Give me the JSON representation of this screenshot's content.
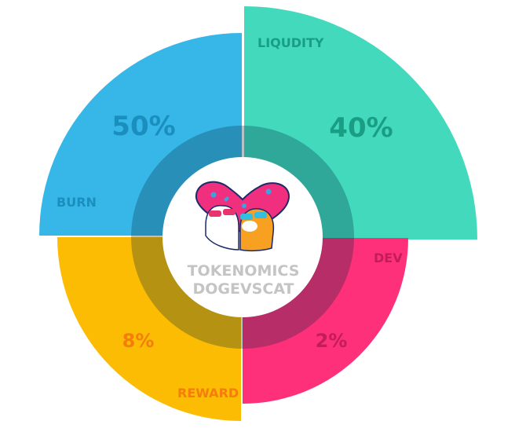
{
  "chart_data": {
    "type": "pie",
    "categories": [
      "LIQUDITY",
      "DEV",
      "REWARD",
      "BURN"
    ],
    "values": [
      40,
      2,
      8,
      50
    ],
    "labels": [
      "40%",
      "2%",
      "8%",
      "50%"
    ],
    "colors": [
      "#42d9bd",
      "#fe3079",
      "#fcbc03",
      "#36b7e8"
    ],
    "label_colors": [
      "#1a9e83",
      "#c21d5b",
      "#f47d0c",
      "#1a8fbd"
    ]
  },
  "center": {
    "title_line1": "TOKENOMICS",
    "title_line2": "DOGEVSCAT",
    "logo_text": "DOGEVSCAT"
  }
}
